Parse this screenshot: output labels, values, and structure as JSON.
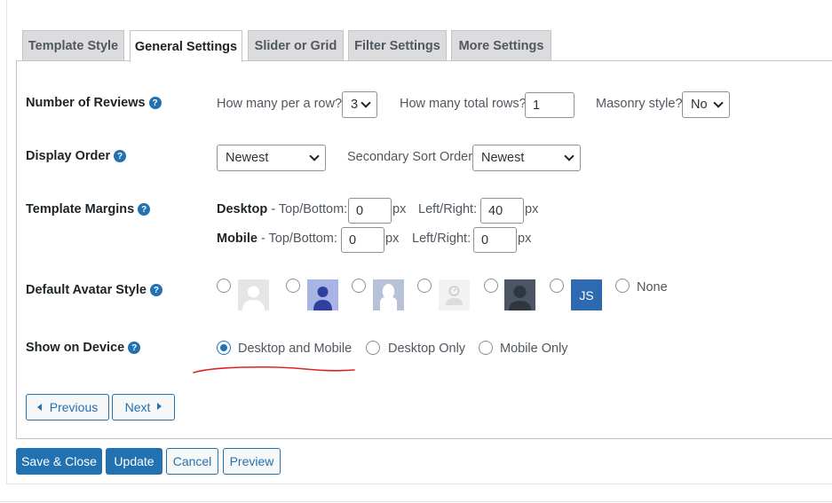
{
  "tabs": [
    {
      "label": "Template Style"
    },
    {
      "label": "General Settings",
      "active": true
    },
    {
      "label": "Slider or Grid"
    },
    {
      "label": "Filter Settings"
    },
    {
      "label": "More Settings"
    }
  ],
  "help_glyph": "?",
  "number_of_reviews": {
    "label": "Number of Reviews",
    "per_row_label": "How many per a row?",
    "per_row_value": "3",
    "total_rows_label": "How many total rows?",
    "total_rows_value": "1",
    "masonry_label": "Masonry style?",
    "masonry_value": "No"
  },
  "display_order": {
    "label": "Display Order",
    "order_value": "Newest",
    "secondary_label": "Secondary Sort Order:",
    "secondary_value": "Newest"
  },
  "template_margins": {
    "label": "Template Margins",
    "desktop_label": "Desktop",
    "desktop_tb_label": " - Top/Bottom:",
    "desktop_tb_value": "0",
    "desktop_lr_label": "Left/Right:",
    "desktop_lr_value": "40",
    "mobile_label": "Mobile",
    "mobile_tb_label": " - Top/Bottom:",
    "mobile_tb_value": "0",
    "mobile_lr_label": "Left/Right:",
    "mobile_lr_value": "0",
    "unit": "px"
  },
  "default_avatar": {
    "label": "Default Avatar Style",
    "options": [
      "avatar-gray-silhouette",
      "avatar-blue-person",
      "avatar-facebook-silhouette",
      "avatar-light-placeholder",
      "avatar-dark-silhouette",
      "avatar-initials",
      "none"
    ],
    "initials": "JS",
    "none_label": "None"
  },
  "show_on_device": {
    "label": "Show on Device",
    "options": [
      "Desktop and Mobile",
      "Desktop Only",
      "Mobile Only"
    ],
    "selected": "Desktop and Mobile"
  },
  "nav": {
    "previous_label": "Previous",
    "next_label": "Next"
  },
  "actions": {
    "save_close_label": "Save & Close",
    "update_label": "Update",
    "cancel_label": "Cancel",
    "preview_label": "Preview"
  },
  "colors": {
    "accent": "#2271b1",
    "annotation": "#e02020"
  }
}
